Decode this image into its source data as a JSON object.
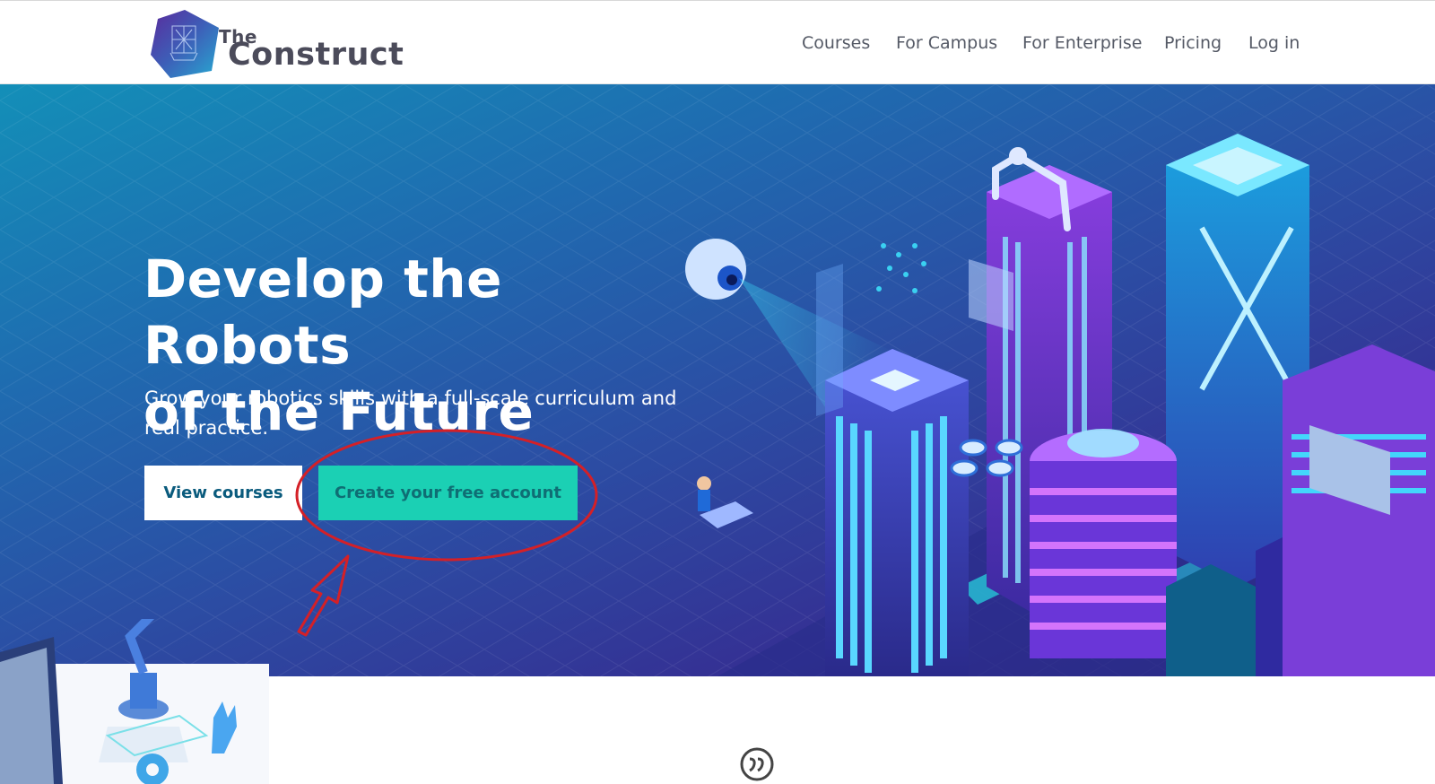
{
  "header": {
    "logo": {
      "line1": "The",
      "line2": "Construct"
    },
    "nav": [
      {
        "label": "Courses"
      },
      {
        "label": "For Campus"
      },
      {
        "label": "For Enterprise"
      },
      {
        "label": "Pricing"
      },
      {
        "label": "Log in"
      }
    ]
  },
  "hero": {
    "title_line1": "Develop the Robots",
    "title_line2": "of the Future",
    "subtitle": "Grow your robotics skills with a full-scale curriculum and real practice.",
    "primary_button": "View courses",
    "cta_button": "Create your free account"
  },
  "colors": {
    "cta": "#1bd0b4",
    "annotation": "#d42027",
    "hero_dark": "#2c2276",
    "hero_light": "#138fb8"
  },
  "icons": [
    "robot-arm-icon",
    "quote-icon",
    "eye-robot-icon",
    "server-tower-icon"
  ]
}
